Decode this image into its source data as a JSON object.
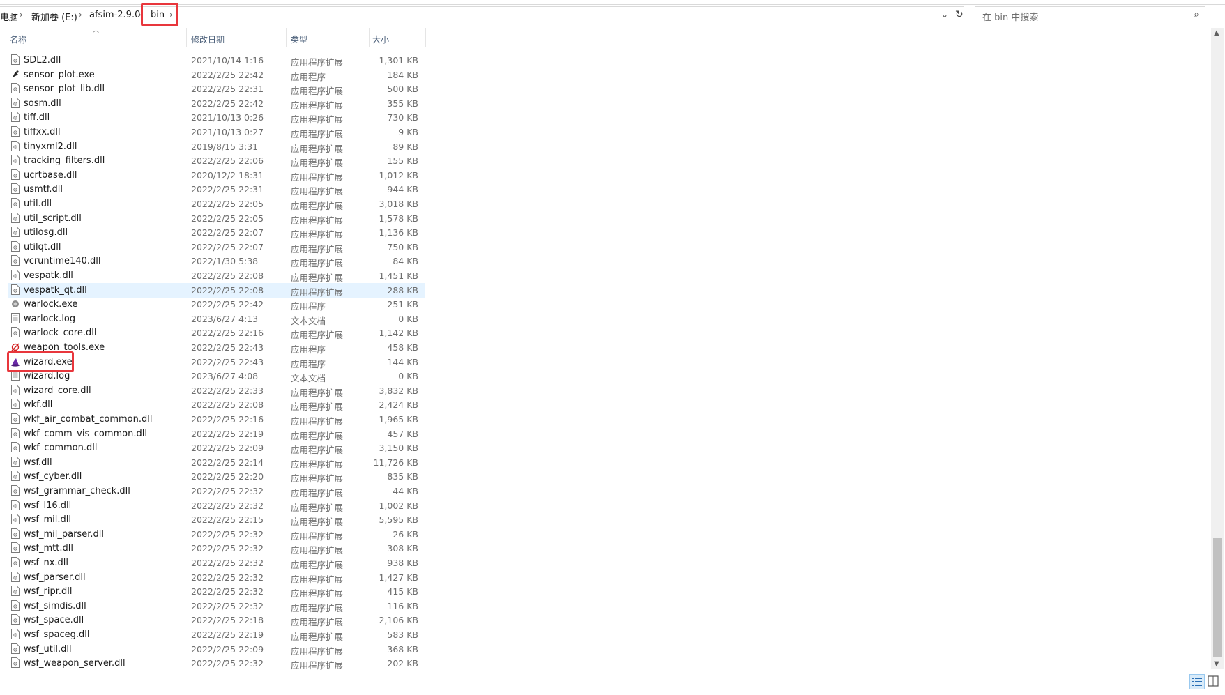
{
  "breadcrumb": {
    "items": [
      "电脑",
      "新加卷 (E:)",
      "afsim-2.9.0",
      "bin"
    ],
    "separator": "›"
  },
  "search": {
    "placeholder": "在 bin 中搜索"
  },
  "columns": {
    "name": "名称",
    "date": "修改日期",
    "type": "类型",
    "size": "大小"
  },
  "highlight_color": "#e8363c",
  "selected_color": "#e5f3ff",
  "files": [
    {
      "name": "SDL2.dll",
      "date": "2021/10/14 1:16",
      "type": "应用程序扩展",
      "size": "1,301 KB",
      "icon": "dll-file-icon"
    },
    {
      "name": "sensor_plot.exe",
      "date": "2022/2/25 22:42",
      "type": "应用程序",
      "size": "184 KB",
      "icon": "satellite-dish-icon"
    },
    {
      "name": "sensor_plot_lib.dll",
      "date": "2022/2/25 22:31",
      "type": "应用程序扩展",
      "size": "500 KB",
      "icon": "dll-file-icon"
    },
    {
      "name": "sosm.dll",
      "date": "2022/2/25 22:42",
      "type": "应用程序扩展",
      "size": "355 KB",
      "icon": "dll-file-icon"
    },
    {
      "name": "tiff.dll",
      "date": "2021/10/13 0:26",
      "type": "应用程序扩展",
      "size": "730 KB",
      "icon": "dll-file-icon"
    },
    {
      "name": "tiffxx.dll",
      "date": "2021/10/13 0:27",
      "type": "应用程序扩展",
      "size": "9 KB",
      "icon": "dll-file-icon"
    },
    {
      "name": "tinyxml2.dll",
      "date": "2019/8/15 3:31",
      "type": "应用程序扩展",
      "size": "89 KB",
      "icon": "dll-file-icon"
    },
    {
      "name": "tracking_filters.dll",
      "date": "2022/2/25 22:06",
      "type": "应用程序扩展",
      "size": "155 KB",
      "icon": "dll-file-icon"
    },
    {
      "name": "ucrtbase.dll",
      "date": "2020/12/2 18:31",
      "type": "应用程序扩展",
      "size": "1,012 KB",
      "icon": "dll-file-icon"
    },
    {
      "name": "usmtf.dll",
      "date": "2022/2/25 22:31",
      "type": "应用程序扩展",
      "size": "944 KB",
      "icon": "dll-file-icon"
    },
    {
      "name": "util.dll",
      "date": "2022/2/25 22:05",
      "type": "应用程序扩展",
      "size": "3,018 KB",
      "icon": "dll-file-icon"
    },
    {
      "name": "util_script.dll",
      "date": "2022/2/25 22:05",
      "type": "应用程序扩展",
      "size": "1,578 KB",
      "icon": "dll-file-icon"
    },
    {
      "name": "utilosg.dll",
      "date": "2022/2/25 22:07",
      "type": "应用程序扩展",
      "size": "1,136 KB",
      "icon": "dll-file-icon"
    },
    {
      "name": "utilqt.dll",
      "date": "2022/2/25 22:07",
      "type": "应用程序扩展",
      "size": "750 KB",
      "icon": "dll-file-icon"
    },
    {
      "name": "vcruntime140.dll",
      "date": "2022/1/30 5:38",
      "type": "应用程序扩展",
      "size": "84 KB",
      "icon": "dll-file-icon"
    },
    {
      "name": "vespatk.dll",
      "date": "2022/2/25 22:08",
      "type": "应用程序扩展",
      "size": "1,451 KB",
      "icon": "dll-file-icon"
    },
    {
      "name": "vespatk_qt.dll",
      "date": "2022/2/25 22:08",
      "type": "应用程序扩展",
      "size": "288 KB",
      "icon": "dll-file-icon",
      "selected": true
    },
    {
      "name": "warlock.exe",
      "date": "2022/2/25 22:42",
      "type": "应用程序",
      "size": "251 KB",
      "icon": "warlock-app-icon"
    },
    {
      "name": "warlock.log",
      "date": "2023/6/27 4:13",
      "type": "文本文档",
      "size": "0 KB",
      "icon": "text-file-icon"
    },
    {
      "name": "warlock_core.dll",
      "date": "2022/2/25 22:16",
      "type": "应用程序扩展",
      "size": "1,142 KB",
      "icon": "dll-file-icon"
    },
    {
      "name": "weapon_tools.exe",
      "date": "2022/2/25 22:43",
      "type": "应用程序",
      "size": "458 KB",
      "icon": "weapon-tools-app-icon"
    },
    {
      "name": "wizard.exe",
      "date": "2022/2/25 22:43",
      "type": "应用程序",
      "size": "144 KB",
      "icon": "wizard-hat-icon",
      "highlighted": true
    },
    {
      "name": "wizard.log",
      "date": "2023/6/27 4:08",
      "type": "文本文档",
      "size": "0 KB",
      "icon": "text-file-icon"
    },
    {
      "name": "wizard_core.dll",
      "date": "2022/2/25 22:33",
      "type": "应用程序扩展",
      "size": "3,832 KB",
      "icon": "dll-file-icon"
    },
    {
      "name": "wkf.dll",
      "date": "2022/2/25 22:08",
      "type": "应用程序扩展",
      "size": "2,424 KB",
      "icon": "dll-file-icon"
    },
    {
      "name": "wkf_air_combat_common.dll",
      "date": "2022/2/25 22:16",
      "type": "应用程序扩展",
      "size": "1,965 KB",
      "icon": "dll-file-icon"
    },
    {
      "name": "wkf_comm_vis_common.dll",
      "date": "2022/2/25 22:19",
      "type": "应用程序扩展",
      "size": "457 KB",
      "icon": "dll-file-icon"
    },
    {
      "name": "wkf_common.dll",
      "date": "2022/2/25 22:09",
      "type": "应用程序扩展",
      "size": "3,150 KB",
      "icon": "dll-file-icon"
    },
    {
      "name": "wsf.dll",
      "date": "2022/2/25 22:14",
      "type": "应用程序扩展",
      "size": "11,726 KB",
      "icon": "dll-file-icon"
    },
    {
      "name": "wsf_cyber.dll",
      "date": "2022/2/25 22:20",
      "type": "应用程序扩展",
      "size": "835 KB",
      "icon": "dll-file-icon"
    },
    {
      "name": "wsf_grammar_check.dll",
      "date": "2022/2/25 22:32",
      "type": "应用程序扩展",
      "size": "44 KB",
      "icon": "dll-file-icon"
    },
    {
      "name": "wsf_l16.dll",
      "date": "2022/2/25 22:32",
      "type": "应用程序扩展",
      "size": "1,002 KB",
      "icon": "dll-file-icon"
    },
    {
      "name": "wsf_mil.dll",
      "date": "2022/2/25 22:15",
      "type": "应用程序扩展",
      "size": "5,595 KB",
      "icon": "dll-file-icon"
    },
    {
      "name": "wsf_mil_parser.dll",
      "date": "2022/2/25 22:32",
      "type": "应用程序扩展",
      "size": "26 KB",
      "icon": "dll-file-icon"
    },
    {
      "name": "wsf_mtt.dll",
      "date": "2022/2/25 22:32",
      "type": "应用程序扩展",
      "size": "308 KB",
      "icon": "dll-file-icon"
    },
    {
      "name": "wsf_nx.dll",
      "date": "2022/2/25 22:32",
      "type": "应用程序扩展",
      "size": "938 KB",
      "icon": "dll-file-icon"
    },
    {
      "name": "wsf_parser.dll",
      "date": "2022/2/25 22:32",
      "type": "应用程序扩展",
      "size": "1,427 KB",
      "icon": "dll-file-icon"
    },
    {
      "name": "wsf_ripr.dll",
      "date": "2022/2/25 22:32",
      "type": "应用程序扩展",
      "size": "415 KB",
      "icon": "dll-file-icon"
    },
    {
      "name": "wsf_simdis.dll",
      "date": "2022/2/25 22:32",
      "type": "应用程序扩展",
      "size": "116 KB",
      "icon": "dll-file-icon"
    },
    {
      "name": "wsf_space.dll",
      "date": "2022/2/25 22:18",
      "type": "应用程序扩展",
      "size": "2,106 KB",
      "icon": "dll-file-icon"
    },
    {
      "name": "wsf_spaceg.dll",
      "date": "2022/2/25 22:19",
      "type": "应用程序扩展",
      "size": "583 KB",
      "icon": "dll-file-icon"
    },
    {
      "name": "wsf_util.dll",
      "date": "2022/2/25 22:09",
      "type": "应用程序扩展",
      "size": "368 KB",
      "icon": "dll-file-icon"
    },
    {
      "name": "wsf_weapon_server.dll",
      "date": "2022/2/25 22:32",
      "type": "应用程序扩展",
      "size": "202 KB",
      "icon": "dll-file-icon"
    }
  ]
}
